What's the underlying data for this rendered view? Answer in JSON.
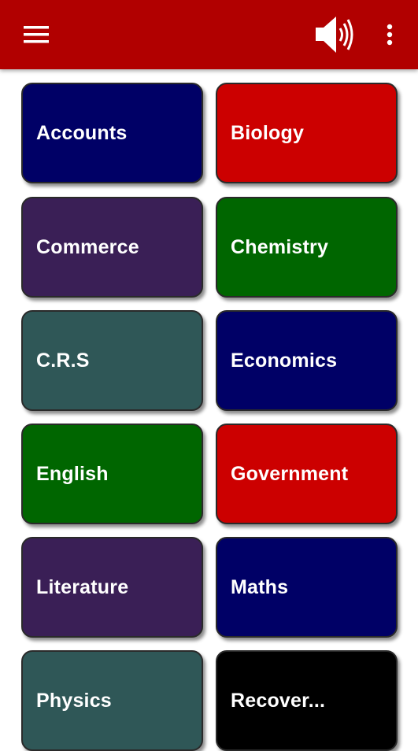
{
  "appbar": {
    "menu_icon": "hamburger-menu-icon",
    "sound_icon": "speaker-volume-icon",
    "more_icon": "more-vertical-icon",
    "background": "#b10000"
  },
  "subjects": [
    {
      "label": "Accounts",
      "color": "#000066"
    },
    {
      "label": "Biology",
      "color": "#cc0000"
    },
    {
      "label": "Commerce",
      "color": "#3a1f56"
    },
    {
      "label": "Chemistry",
      "color": "#006600"
    },
    {
      "label": "C.R.S",
      "color": "#2f5757"
    },
    {
      "label": "Economics",
      "color": "#000066"
    },
    {
      "label": "English",
      "color": "#006600"
    },
    {
      "label": "Government",
      "color": "#cc0000"
    },
    {
      "label": "Literature",
      "color": "#3a1f56"
    },
    {
      "label": "Maths",
      "color": "#000066"
    },
    {
      "label": "Physics",
      "color": "#2f5757"
    },
    {
      "label": "Recover...",
      "color": "#000000"
    }
  ]
}
